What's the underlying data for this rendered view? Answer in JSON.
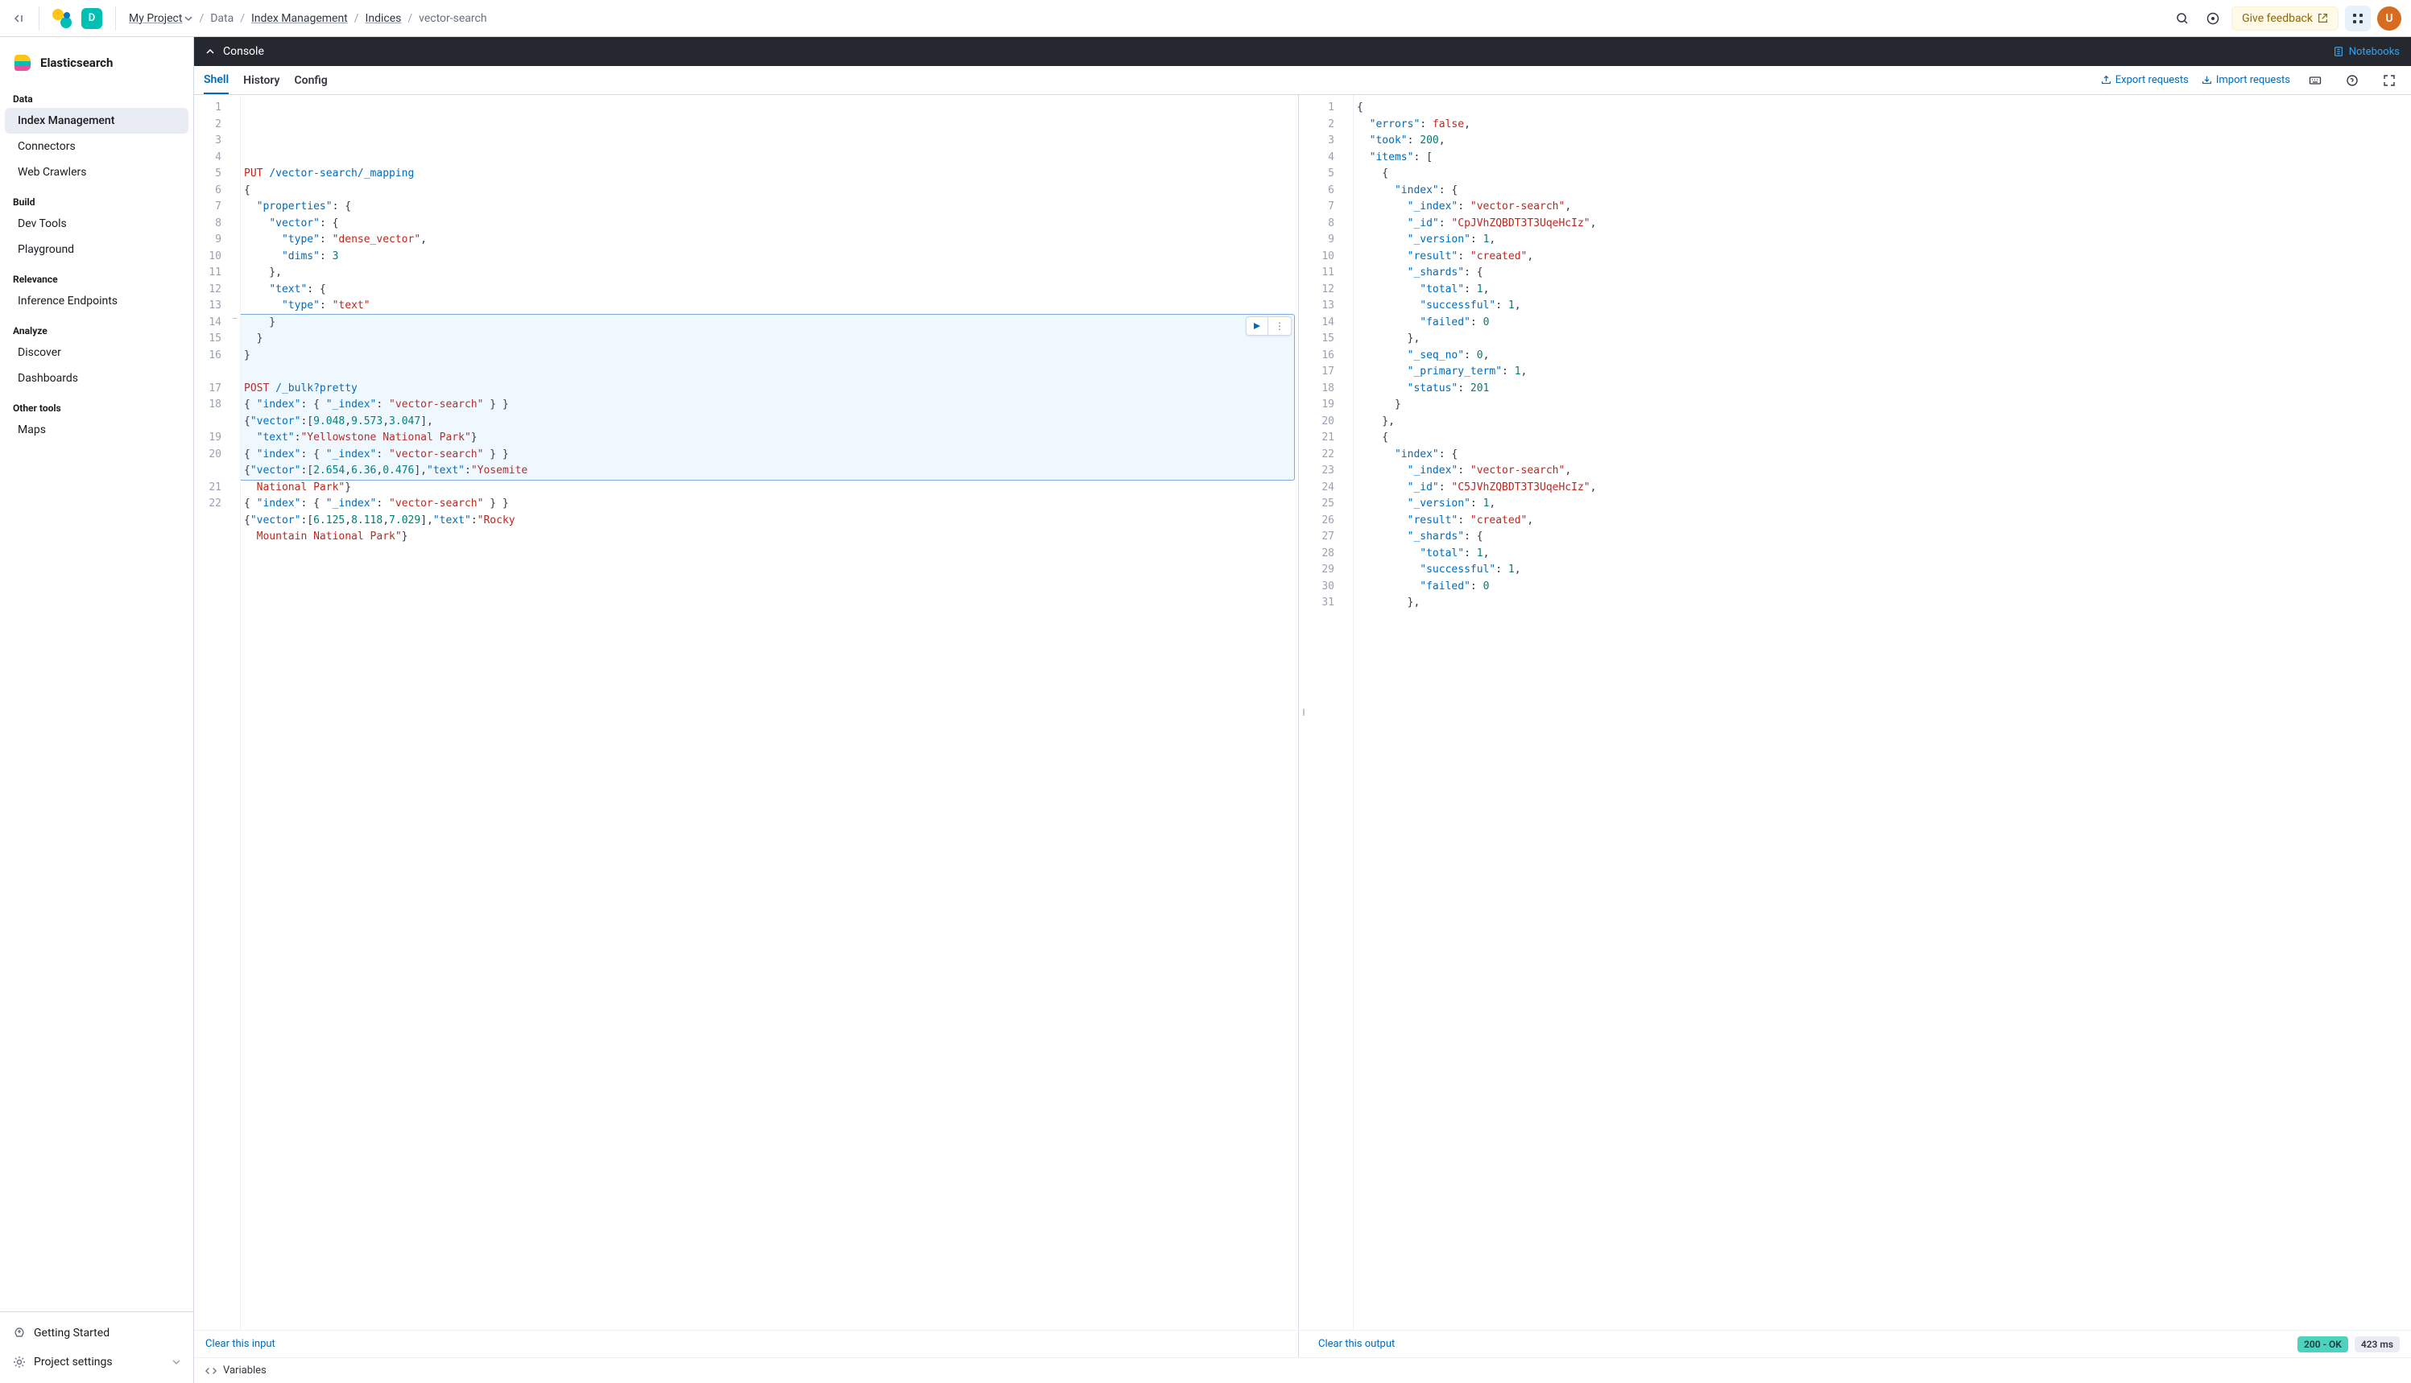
{
  "topbar": {
    "deployment_initial": "D",
    "breadcrumbs": {
      "project": "My Project",
      "data": "Data",
      "index_mgmt": "Index Management",
      "indices": "Indices",
      "current": "vector-search"
    },
    "feedback": "Give feedback",
    "avatar_initial": "U"
  },
  "sidebar": {
    "title": "Elasticsearch",
    "sections": [
      {
        "label": "Data",
        "items": [
          "Index Management",
          "Connectors",
          "Web Crawlers"
        ]
      },
      {
        "label": "Build",
        "items": [
          "Dev Tools",
          "Playground"
        ]
      },
      {
        "label": "Relevance",
        "items": [
          "Inference Endpoints"
        ]
      },
      {
        "label": "Analyze",
        "items": [
          "Discover",
          "Dashboards"
        ]
      },
      {
        "label": "Other tools",
        "items": [
          "Maps"
        ]
      }
    ],
    "active_item": "Index Management",
    "footer": {
      "getting_started": "Getting Started",
      "project_settings": "Project settings"
    }
  },
  "console": {
    "title": "Console",
    "notebooks": "Notebooks",
    "tabs": [
      "Shell",
      "History",
      "Config"
    ],
    "active_tab": "Shell",
    "export": "Export requests",
    "import": "Import requests"
  },
  "editor_input": {
    "line_count": 22,
    "highlight_start": 14,
    "highlight_end": 20,
    "lines": [
      [
        [
          "kw",
          "PUT"
        ],
        [
          "punc",
          " "
        ],
        [
          "path",
          "/vector-search/_mapping"
        ]
      ],
      [
        [
          "punc",
          "{"
        ]
      ],
      [
        [
          "punc",
          "  "
        ],
        [
          "key",
          "\"properties\""
        ],
        [
          "punc",
          ": {"
        ]
      ],
      [
        [
          "punc",
          "    "
        ],
        [
          "key",
          "\"vector\""
        ],
        [
          "punc",
          ": {"
        ]
      ],
      [
        [
          "punc",
          "      "
        ],
        [
          "key",
          "\"type\""
        ],
        [
          "punc",
          ": "
        ],
        [
          "str",
          "\"dense_vector\""
        ],
        [
          "punc",
          ","
        ]
      ],
      [
        [
          "punc",
          "      "
        ],
        [
          "key",
          "\"dims\""
        ],
        [
          "punc",
          ": "
        ],
        [
          "num",
          "3"
        ]
      ],
      [
        [
          "punc",
          "    },"
        ]
      ],
      [
        [
          "punc",
          "    "
        ],
        [
          "key",
          "\"text\""
        ],
        [
          "punc",
          ": {"
        ]
      ],
      [
        [
          "punc",
          "      "
        ],
        [
          "key",
          "\"type\""
        ],
        [
          "punc",
          ": "
        ],
        [
          "str",
          "\"text\""
        ]
      ],
      [
        [
          "punc",
          "    }"
        ]
      ],
      [
        [
          "punc",
          "  }"
        ]
      ],
      [
        [
          "punc",
          "}"
        ]
      ],
      [
        [
          "punc",
          ""
        ]
      ],
      [
        [
          "kw",
          "POST"
        ],
        [
          "punc",
          " "
        ],
        [
          "path",
          "/_bulk?pretty"
        ]
      ],
      [
        [
          "punc",
          "{ "
        ],
        [
          "key",
          "\"index\""
        ],
        [
          "punc",
          ": { "
        ],
        [
          "key",
          "\"_index\""
        ],
        [
          "punc",
          ": "
        ],
        [
          "str",
          "\"vector-search\""
        ],
        [
          "punc",
          " } }"
        ]
      ],
      [
        [
          "punc",
          "{"
        ],
        [
          "key",
          "\"vector\""
        ],
        [
          "punc",
          ":["
        ],
        [
          "num",
          "9.048"
        ],
        [
          "punc",
          ","
        ],
        [
          "num",
          "9.573"
        ],
        [
          "punc",
          ","
        ],
        [
          "num",
          "3.047"
        ],
        [
          "punc",
          "],"
        ]
      ],
      [
        [
          "punc",
          "  "
        ],
        [
          "key",
          "\"text\""
        ],
        [
          "punc",
          ":"
        ],
        [
          "str",
          "\"Yellowstone National Park\""
        ],
        [
          "punc",
          "}"
        ]
      ],
      [
        [
          "punc",
          "{ "
        ],
        [
          "key",
          "\"index\""
        ],
        [
          "punc",
          ": { "
        ],
        [
          "key",
          "\"_index\""
        ],
        [
          "punc",
          ": "
        ],
        [
          "str",
          "\"vector-search\""
        ],
        [
          "punc",
          " } }"
        ]
      ],
      [
        [
          "punc",
          "{"
        ],
        [
          "key",
          "\"vector\""
        ],
        [
          "punc",
          ":["
        ],
        [
          "num",
          "2.654"
        ],
        [
          "punc",
          ","
        ],
        [
          "num",
          "6.36"
        ],
        [
          "punc",
          ","
        ],
        [
          "num",
          "0.476"
        ],
        [
          "punc",
          "],"
        ],
        [
          "key",
          "\"text\""
        ],
        [
          "punc",
          ":"
        ],
        [
          "str",
          "\"Yosemite"
        ]
      ],
      [
        [
          "punc",
          "  "
        ],
        [
          "str",
          "National Park\""
        ],
        [
          "punc",
          "}"
        ]
      ],
      [
        [
          "punc",
          "{ "
        ],
        [
          "key",
          "\"index\""
        ],
        [
          "punc",
          ": { "
        ],
        [
          "key",
          "\"_index\""
        ],
        [
          "punc",
          ": "
        ],
        [
          "str",
          "\"vector-search\""
        ],
        [
          "punc",
          " } }"
        ]
      ],
      [
        [
          "punc",
          "{"
        ],
        [
          "key",
          "\"vector\""
        ],
        [
          "punc",
          ":["
        ],
        [
          "num",
          "6.125"
        ],
        [
          "punc",
          ","
        ],
        [
          "num",
          "8.118"
        ],
        [
          "punc",
          ","
        ],
        [
          "num",
          "7.029"
        ],
        [
          "punc",
          "],"
        ],
        [
          "key",
          "\"text\""
        ],
        [
          "punc",
          ":"
        ],
        [
          "str",
          "\"Rocky"
        ]
      ],
      [
        [
          "punc",
          "  "
        ],
        [
          "str",
          "Mountain National Park\""
        ],
        [
          "punc",
          "}"
        ]
      ],
      [
        [
          "punc",
          ""
        ]
      ],
      [
        [
          "punc",
          ""
        ]
      ]
    ],
    "display_numbers": [
      "1",
      "2",
      "3",
      "4",
      "5",
      "6",
      "7",
      "8",
      "9",
      "10",
      "11",
      "12",
      "13",
      "14",
      "15",
      "16",
      "17",
      "18",
      "19",
      "20",
      "21",
      "22"
    ],
    "wrap_map": {
      "16": 2,
      "18": 2,
      "20": 2
    }
  },
  "editor_output": {
    "line_count": 31,
    "lines": [
      [
        [
          "punc",
          "{"
        ]
      ],
      [
        [
          "punc",
          "  "
        ],
        [
          "key",
          "\"errors\""
        ],
        [
          "punc",
          ": "
        ],
        [
          "bool",
          "false"
        ],
        [
          "punc",
          ","
        ]
      ],
      [
        [
          "punc",
          "  "
        ],
        [
          "key",
          "\"took\""
        ],
        [
          "punc",
          ": "
        ],
        [
          "num",
          "200"
        ],
        [
          "punc",
          ","
        ]
      ],
      [
        [
          "punc",
          "  "
        ],
        [
          "key",
          "\"items\""
        ],
        [
          "punc",
          ": ["
        ]
      ],
      [
        [
          "punc",
          "    {"
        ]
      ],
      [
        [
          "punc",
          "      "
        ],
        [
          "key",
          "\"index\""
        ],
        [
          "punc",
          ": {"
        ]
      ],
      [
        [
          "punc",
          "        "
        ],
        [
          "key",
          "\"_index\""
        ],
        [
          "punc",
          ": "
        ],
        [
          "str",
          "\"vector-search\""
        ],
        [
          "punc",
          ","
        ]
      ],
      [
        [
          "punc",
          "        "
        ],
        [
          "key",
          "\"_id\""
        ],
        [
          "punc",
          ": "
        ],
        [
          "str",
          "\"CpJVhZQBDT3T3UqeHcIz\""
        ],
        [
          "punc",
          ","
        ]
      ],
      [
        [
          "punc",
          "        "
        ],
        [
          "key",
          "\"_version\""
        ],
        [
          "punc",
          ": "
        ],
        [
          "num",
          "1"
        ],
        [
          "punc",
          ","
        ]
      ],
      [
        [
          "punc",
          "        "
        ],
        [
          "key",
          "\"result\""
        ],
        [
          "punc",
          ": "
        ],
        [
          "str",
          "\"created\""
        ],
        [
          "punc",
          ","
        ]
      ],
      [
        [
          "punc",
          "        "
        ],
        [
          "key",
          "\"_shards\""
        ],
        [
          "punc",
          ": {"
        ]
      ],
      [
        [
          "punc",
          "          "
        ],
        [
          "key",
          "\"total\""
        ],
        [
          "punc",
          ": "
        ],
        [
          "num",
          "1"
        ],
        [
          "punc",
          ","
        ]
      ],
      [
        [
          "punc",
          "          "
        ],
        [
          "key",
          "\"successful\""
        ],
        [
          "punc",
          ": "
        ],
        [
          "num",
          "1"
        ],
        [
          "punc",
          ","
        ]
      ],
      [
        [
          "punc",
          "          "
        ],
        [
          "key",
          "\"failed\""
        ],
        [
          "punc",
          ": "
        ],
        [
          "num",
          "0"
        ]
      ],
      [
        [
          "punc",
          "        },"
        ]
      ],
      [
        [
          "punc",
          "        "
        ],
        [
          "key",
          "\"_seq_no\""
        ],
        [
          "punc",
          ": "
        ],
        [
          "num",
          "0"
        ],
        [
          "punc",
          ","
        ]
      ],
      [
        [
          "punc",
          "        "
        ],
        [
          "key",
          "\"_primary_term\""
        ],
        [
          "punc",
          ": "
        ],
        [
          "num",
          "1"
        ],
        [
          "punc",
          ","
        ]
      ],
      [
        [
          "punc",
          "        "
        ],
        [
          "key",
          "\"status\""
        ],
        [
          "punc",
          ": "
        ],
        [
          "num",
          "201"
        ]
      ],
      [
        [
          "punc",
          "      }"
        ]
      ],
      [
        [
          "punc",
          "    },"
        ]
      ],
      [
        [
          "punc",
          "    {"
        ]
      ],
      [
        [
          "punc",
          "      "
        ],
        [
          "key",
          "\"index\""
        ],
        [
          "punc",
          ": {"
        ]
      ],
      [
        [
          "punc",
          "        "
        ],
        [
          "key",
          "\"_index\""
        ],
        [
          "punc",
          ": "
        ],
        [
          "str",
          "\"vector-search\""
        ],
        [
          "punc",
          ","
        ]
      ],
      [
        [
          "punc",
          "        "
        ],
        [
          "key",
          "\"_id\""
        ],
        [
          "punc",
          ": "
        ],
        [
          "str",
          "\"C5JVhZQBDT3T3UqeHcIz\""
        ],
        [
          "punc",
          ","
        ]
      ],
      [
        [
          "punc",
          "        "
        ],
        [
          "key",
          "\"_version\""
        ],
        [
          "punc",
          ": "
        ],
        [
          "num",
          "1"
        ],
        [
          "punc",
          ","
        ]
      ],
      [
        [
          "punc",
          "        "
        ],
        [
          "key",
          "\"result\""
        ],
        [
          "punc",
          ": "
        ],
        [
          "str",
          "\"created\""
        ],
        [
          "punc",
          ","
        ]
      ],
      [
        [
          "punc",
          "        "
        ],
        [
          "key",
          "\"_shards\""
        ],
        [
          "punc",
          ": {"
        ]
      ],
      [
        [
          "punc",
          "          "
        ],
        [
          "key",
          "\"total\""
        ],
        [
          "punc",
          ": "
        ],
        [
          "num",
          "1"
        ],
        [
          "punc",
          ","
        ]
      ],
      [
        [
          "punc",
          "          "
        ],
        [
          "key",
          "\"successful\""
        ],
        [
          "punc",
          ": "
        ],
        [
          "num",
          "1"
        ],
        [
          "punc",
          ","
        ]
      ],
      [
        [
          "punc",
          "          "
        ],
        [
          "key",
          "\"failed\""
        ],
        [
          "punc",
          ": "
        ],
        [
          "num",
          "0"
        ]
      ],
      [
        [
          "punc",
          "        },"
        ]
      ]
    ]
  },
  "footer": {
    "clear_input": "Clear this input",
    "clear_output": "Clear this output",
    "status_badge": "200 - OK",
    "time_badge": "423 ms",
    "variables": "Variables"
  }
}
